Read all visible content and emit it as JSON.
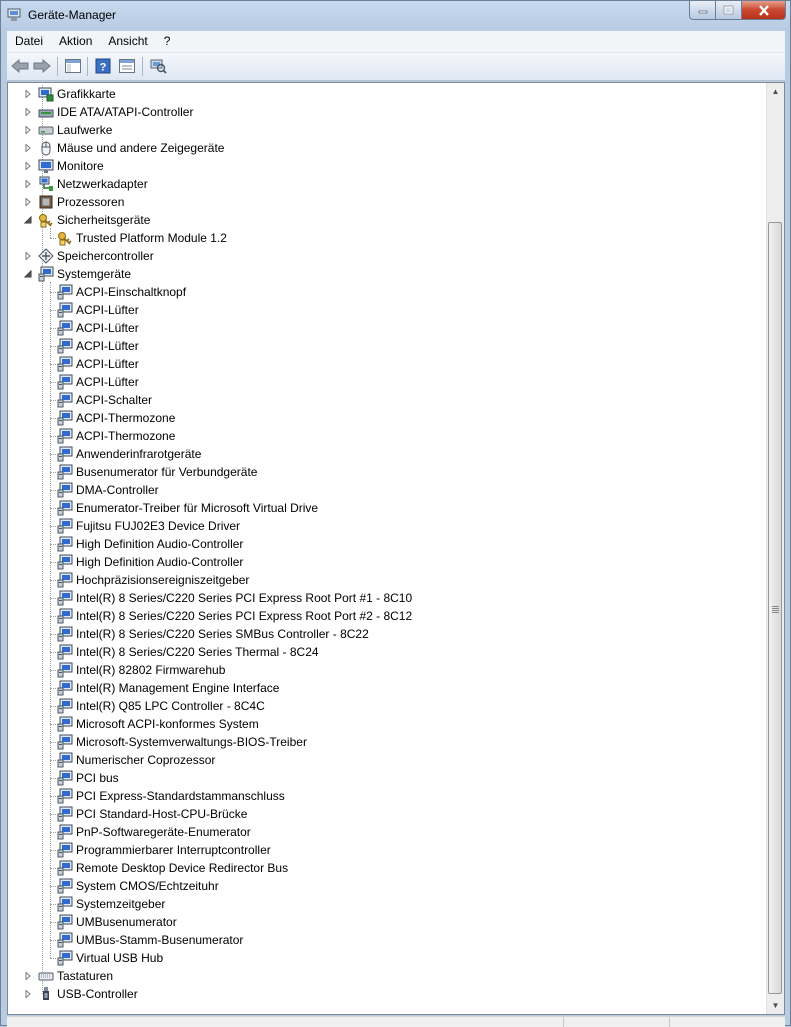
{
  "window": {
    "title": "Geräte-Manager"
  },
  "menu": [
    "Datei",
    "Aktion",
    "Ansicht",
    "?"
  ],
  "toolbar": {
    "buttons": [
      {
        "name": "back-button",
        "icon": "arrow-left-icon"
      },
      {
        "name": "forward-button",
        "icon": "arrow-right-icon"
      },
      {
        "name": "show-hide-console-tree-button",
        "icon": "console-tree-icon"
      },
      {
        "name": "help-button",
        "icon": "help-icon"
      },
      {
        "name": "properties-button",
        "icon": "properties-icon"
      },
      {
        "name": "scan-hardware-button",
        "icon": "scan-hardware-icon"
      }
    ]
  },
  "tree": [
    {
      "label": "Grafikkarte",
      "level": 0,
      "state": "collapsed",
      "icon": "display-adapter-icon"
    },
    {
      "label": "IDE ATA/ATAPI-Controller",
      "level": 0,
      "state": "collapsed",
      "icon": "ide-controller-icon"
    },
    {
      "label": "Laufwerke",
      "level": 0,
      "state": "collapsed",
      "icon": "disk-drive-icon"
    },
    {
      "label": "Mäuse und andere Zeigegeräte",
      "level": 0,
      "state": "collapsed",
      "icon": "mouse-icon"
    },
    {
      "label": "Monitore",
      "level": 0,
      "state": "collapsed",
      "icon": "monitor-icon"
    },
    {
      "label": "Netzwerkadapter",
      "level": 0,
      "state": "collapsed",
      "icon": "network-adapter-icon"
    },
    {
      "label": "Prozessoren",
      "level": 0,
      "state": "collapsed",
      "icon": "processor-icon"
    },
    {
      "label": "Sicherheitsgeräte",
      "level": 0,
      "state": "expanded",
      "icon": "security-device-icon"
    },
    {
      "label": "Trusted Platform Module 1.2",
      "level": 1,
      "state": "leaf",
      "icon": "security-device-icon"
    },
    {
      "label": "Speichercontroller",
      "level": 0,
      "state": "collapsed",
      "icon": "storage-controller-icon"
    },
    {
      "label": "Systemgeräte",
      "level": 0,
      "state": "expanded",
      "icon": "system-device-icon"
    },
    {
      "label": "ACPI-Einschaltknopf",
      "level": 1,
      "state": "leaf",
      "icon": "system-device-icon"
    },
    {
      "label": "ACPI-Lüfter",
      "level": 1,
      "state": "leaf",
      "icon": "system-device-icon"
    },
    {
      "label": "ACPI-Lüfter",
      "level": 1,
      "state": "leaf",
      "icon": "system-device-icon"
    },
    {
      "label": "ACPI-Lüfter",
      "level": 1,
      "state": "leaf",
      "icon": "system-device-icon"
    },
    {
      "label": "ACPI-Lüfter",
      "level": 1,
      "state": "leaf",
      "icon": "system-device-icon"
    },
    {
      "label": "ACPI-Lüfter",
      "level": 1,
      "state": "leaf",
      "icon": "system-device-icon"
    },
    {
      "label": "ACPI-Schalter",
      "level": 1,
      "state": "leaf",
      "icon": "system-device-icon"
    },
    {
      "label": "ACPI-Thermozone",
      "level": 1,
      "state": "leaf",
      "icon": "system-device-icon"
    },
    {
      "label": "ACPI-Thermozone",
      "level": 1,
      "state": "leaf",
      "icon": "system-device-icon"
    },
    {
      "label": "Anwenderinfrarotgeräte",
      "level": 1,
      "state": "leaf",
      "icon": "system-device-icon"
    },
    {
      "label": "Busenumerator für Verbundgeräte",
      "level": 1,
      "state": "leaf",
      "icon": "system-device-icon"
    },
    {
      "label": "DMA-Controller",
      "level": 1,
      "state": "leaf",
      "icon": "system-device-icon"
    },
    {
      "label": "Enumerator-Treiber für Microsoft Virtual Drive",
      "level": 1,
      "state": "leaf",
      "icon": "system-device-icon"
    },
    {
      "label": "Fujitsu FUJ02E3 Device Driver",
      "level": 1,
      "state": "leaf",
      "icon": "system-device-icon"
    },
    {
      "label": "High Definition Audio-Controller",
      "level": 1,
      "state": "leaf",
      "icon": "system-device-icon"
    },
    {
      "label": "High Definition Audio-Controller",
      "level": 1,
      "state": "leaf",
      "icon": "system-device-icon"
    },
    {
      "label": "Hochpräzisionsereigniszeitgeber",
      "level": 1,
      "state": "leaf",
      "icon": "system-device-icon"
    },
    {
      "label": "Intel(R) 8 Series/C220 Series PCI Express Root Port #1 - 8C10",
      "level": 1,
      "state": "leaf",
      "icon": "system-device-icon"
    },
    {
      "label": "Intel(R) 8 Series/C220 Series PCI Express Root Port #2 - 8C12",
      "level": 1,
      "state": "leaf",
      "icon": "system-device-icon"
    },
    {
      "label": "Intel(R) 8 Series/C220 Series SMBus Controller - 8C22",
      "level": 1,
      "state": "leaf",
      "icon": "system-device-icon"
    },
    {
      "label": "Intel(R) 8 Series/C220 Series Thermal - 8C24",
      "level": 1,
      "state": "leaf",
      "icon": "system-device-icon"
    },
    {
      "label": "Intel(R) 82802 Firmwarehub",
      "level": 1,
      "state": "leaf",
      "icon": "system-device-icon"
    },
    {
      "label": "Intel(R) Management Engine Interface",
      "level": 1,
      "state": "leaf",
      "icon": "system-device-icon"
    },
    {
      "label": "Intel(R) Q85 LPC Controller - 8C4C",
      "level": 1,
      "state": "leaf",
      "icon": "system-device-icon"
    },
    {
      "label": "Microsoft ACPI-konformes System",
      "level": 1,
      "state": "leaf",
      "icon": "system-device-icon"
    },
    {
      "label": "Microsoft-Systemverwaltungs-BIOS-Treiber",
      "level": 1,
      "state": "leaf",
      "icon": "system-device-icon"
    },
    {
      "label": "Numerischer Coprozessor",
      "level": 1,
      "state": "leaf",
      "icon": "system-device-icon"
    },
    {
      "label": "PCI bus",
      "level": 1,
      "state": "leaf",
      "icon": "system-device-icon"
    },
    {
      "label": "PCI Express-Standardstammanschluss",
      "level": 1,
      "state": "leaf",
      "icon": "system-device-icon"
    },
    {
      "label": "PCI Standard-Host-CPU-Brücke",
      "level": 1,
      "state": "leaf",
      "icon": "system-device-icon"
    },
    {
      "label": "PnP-Softwaregeräte-Enumerator",
      "level": 1,
      "state": "leaf",
      "icon": "system-device-icon"
    },
    {
      "label": "Programmierbarer Interruptcontroller",
      "level": 1,
      "state": "leaf",
      "icon": "system-device-icon"
    },
    {
      "label": "Remote Desktop Device Redirector Bus",
      "level": 1,
      "state": "leaf",
      "icon": "system-device-icon"
    },
    {
      "label": "System CMOS/Echtzeituhr",
      "level": 1,
      "state": "leaf",
      "icon": "system-device-icon"
    },
    {
      "label": "Systemzeitgeber",
      "level": 1,
      "state": "leaf",
      "icon": "system-device-icon"
    },
    {
      "label": "UMBusenumerator",
      "level": 1,
      "state": "leaf",
      "icon": "system-device-icon"
    },
    {
      "label": "UMBus-Stamm-Busenumerator",
      "level": 1,
      "state": "leaf",
      "icon": "system-device-icon"
    },
    {
      "label": "Virtual USB Hub",
      "level": 1,
      "state": "leaf",
      "icon": "system-device-icon"
    },
    {
      "label": "Tastaturen",
      "level": 0,
      "state": "collapsed",
      "icon": "keyboard-icon"
    },
    {
      "label": "USB-Controller",
      "level": 0,
      "state": "collapsed",
      "icon": "usb-controller-icon"
    }
  ],
  "colors": {
    "titlebar": "#b9cde5",
    "close": "#c9472f",
    "selection": "#3399ff"
  }
}
